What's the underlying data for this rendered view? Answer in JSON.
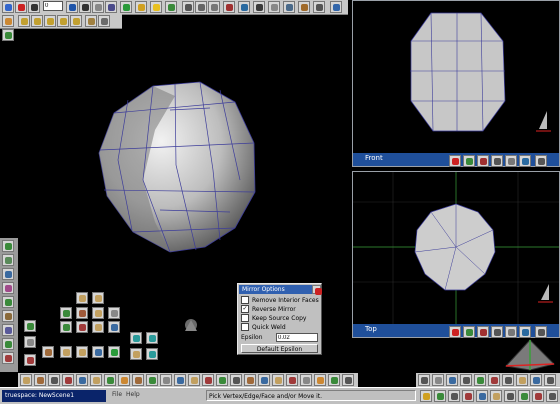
{
  "top_toolbar": {
    "frame_value": "0"
  },
  "front_viewport": {
    "label": "Front"
  },
  "top_viewport": {
    "label": "Top"
  },
  "mirror_options": {
    "title": "Mirror Options",
    "remove_interior_faces": {
      "label": "Remove Interior Faces",
      "checked": false
    },
    "reverse_mirror": {
      "label": "Reverse Mirror",
      "checked": true
    },
    "keep_source_copy": {
      "label": "Keep Source Copy",
      "checked": false
    },
    "quick_weld": {
      "label": "Quick Weld",
      "checked": false
    },
    "epsilon_label": "Epsilon",
    "epsilon_value": "0.02",
    "default_button": "Default Epsilon"
  },
  "status_bar": {
    "app_title": "truespace: NewScene1",
    "menu_file": "File",
    "menu_help": "Help",
    "hint": "Pick Vertex/Edge/Face and/or Move it."
  },
  "colors": {
    "viewport_title_bar": "#1f4f9a",
    "dialog_title": "#3060b0",
    "model_line": "#3d3d9a"
  }
}
